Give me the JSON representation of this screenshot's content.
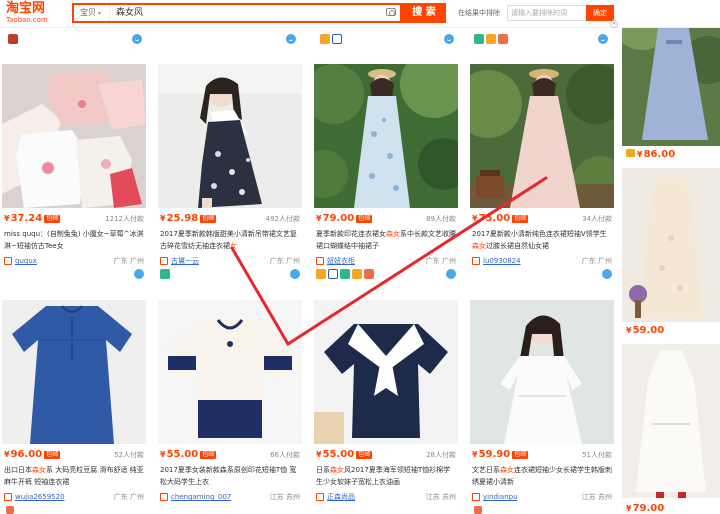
{
  "header": {
    "logo_cn": "淘宝网",
    "logo_en": "Taobao.com",
    "search_scope": "宝贝",
    "search_query": "森女风",
    "search_button": "搜 索",
    "rank_label": "在结果中排除",
    "rank_placeholder": "请输入要排除的词",
    "rank_confirm": "确定",
    "close": "×"
  },
  "colors": {
    "brand": "#ff4400",
    "link": "#3366cc",
    "wangwang": "#4aa7e8",
    "annotation_stroke": "#e8262b"
  },
  "products": [
    {
      "price": "37.24",
      "badge": "包邮",
      "deals": "1212人付款",
      "title_parts": [
        "miss ququ：(自制兔兔) 小魔女~草莓^冰淇淋~短袖仿古Tee女"
      ],
      "shop": "ququx",
      "location": "广东 广州",
      "icons": []
    },
    {
      "price": "25.98",
      "badge": "包邮",
      "deals": "492人付款",
      "title_parts": [
        "2017夏季新款韩版甜美小清新吊带裙文艺复古碎花雪纺无袖连衣裙",
        "女"
      ],
      "shop": "古黛一云",
      "location": "广东 广州",
      "icons": [
        "store-badge-icon"
      ]
    },
    {
      "price": "79.00",
      "badge": "包邮",
      "deals": "89人付款",
      "title_parts": [
        "夏季新款印花连衣裙女",
        "森女",
        "系中长款文艺收腰裙口蝴蝶结中袖裙子"
      ],
      "shop": "妞妞衣柜",
      "location": "广东 广州",
      "icons": [
        "crown-icon",
        "brand-icon",
        "assure-icon",
        "new-icon",
        "gift-icon"
      ]
    },
    {
      "price": "75.00",
      "badge": "包邮",
      "deals": "34人付款",
      "title_parts": [
        "2017夏新款小清新纯色连衣裙短袖V领学生",
        "森女",
        "过膝长裙自然仙女裙"
      ],
      "shop": "lu0930824",
      "location": "广东 广州",
      "icons": []
    },
    {
      "price": "96.00",
      "badge": "包邮",
      "deals": "52人付款",
      "title_parts": [
        "出口日本",
        "森女",
        "系 大码亮粒豆腐 滑布舒适 纯亚麻牛开裤 短袖连衣裙"
      ],
      "shop": "wujia2659520",
      "location": "广东 广州",
      "icons": []
    },
    {
      "price": "55.00",
      "badge": "包邮",
      "deals": "66人付款",
      "title_parts": [
        "2017夏季女装新款森系原创印花短袖T恤 宽松大码学生上衣"
      ],
      "shop": "chengaming_007",
      "location": "江苏 苏州",
      "icons": []
    },
    {
      "price": "55.00",
      "badge": "包邮",
      "deals": "28人付款",
      "title_parts": [
        "日系",
        "森女",
        "风2017夏季海军领短袖T恤衫棉学生少女软妹子宽松上衣油画"
      ],
      "shop": "正森尚品",
      "location": "江苏 苏州",
      "icons": []
    },
    {
      "price": "59.90",
      "badge": "包邮",
      "deals": "51人付款",
      "title_parts": [
        "文艺日系",
        "森女",
        "连衣裙短袖少女长裙学生韩版刺绣夏裙小清新"
      ],
      "shop": "yindianpu",
      "location": "江苏 苏州",
      "icons": []
    }
  ],
  "right_column": [
    {
      "price": "86.00"
    },
    {
      "price": "59.00"
    },
    {
      "price": "79.00"
    }
  ]
}
